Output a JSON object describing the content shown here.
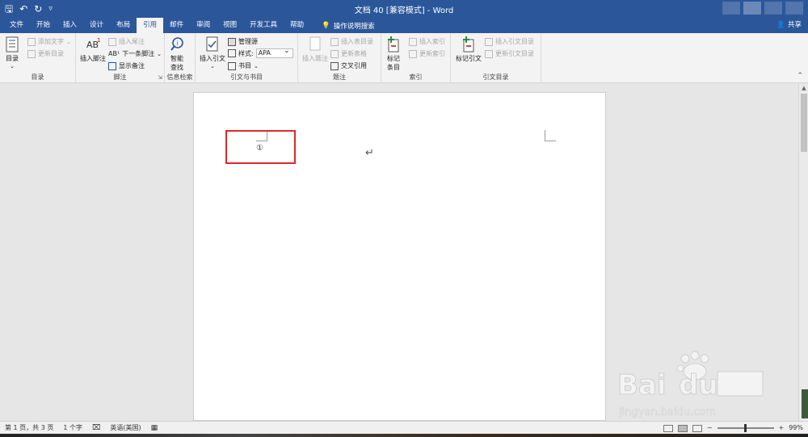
{
  "window": {
    "title": "文档 40 [兼容模式] - Word"
  },
  "menu": {
    "tabs": [
      "文件",
      "开始",
      "插入",
      "设计",
      "布局",
      "引用",
      "邮件",
      "审阅",
      "视图",
      "开发工具",
      "帮助"
    ],
    "active_tab": "引用",
    "tell_me": "操作说明搜索",
    "share": "共享"
  },
  "ribbon": {
    "toc": {
      "big_button": "目录",
      "add_text": "添加文字",
      "update_table": "更新目录",
      "group_label": "目录"
    },
    "footnotes": {
      "insert_footnote": "插入脚注",
      "insert_endnote": "插入尾注",
      "next_footnote": "下一条脚注",
      "show_notes": "显示备注",
      "group_label": "脚注"
    },
    "research": {
      "smart_lookup_line1": "智能",
      "smart_lookup_line2": "查找",
      "group_label": "信息检索"
    },
    "citations": {
      "insert_citation": "插入引文",
      "manage_sources": "管理源",
      "style_label": "样式:",
      "style_value": "APA",
      "bibliography": "书目",
      "group_label": "引文与书目"
    },
    "captions": {
      "insert_caption": "插入题注",
      "insert_table_of_figures": "插入表目录",
      "update_table": "更新表格",
      "cross_reference": "交叉引用",
      "group_label": "题注"
    },
    "index": {
      "mark_entry_line1": "标记",
      "mark_entry_line2": "条目",
      "insert_index": "插入索引",
      "update_index": "更新索引",
      "group_label": "索引"
    },
    "table_of_authorities": {
      "mark_citation": "标记引文",
      "insert_table": "插入引文目录",
      "update_table": "更新引文目录",
      "group_label": "引文目录"
    }
  },
  "document": {
    "footnote_mark": "①",
    "paragraph_mark": "↵"
  },
  "statusbar": {
    "page_info": "第 1 页，共 3 页",
    "word_count": "1 个字",
    "language": "英语(美国)",
    "zoom": "99%",
    "zoom_level": 0.99
  },
  "colors": {
    "titlebar": "#2b579a",
    "highlight_box": "#e0272b"
  },
  "watermark": {
    "text": "Baidu经验 jingyan.baidu.com"
  }
}
